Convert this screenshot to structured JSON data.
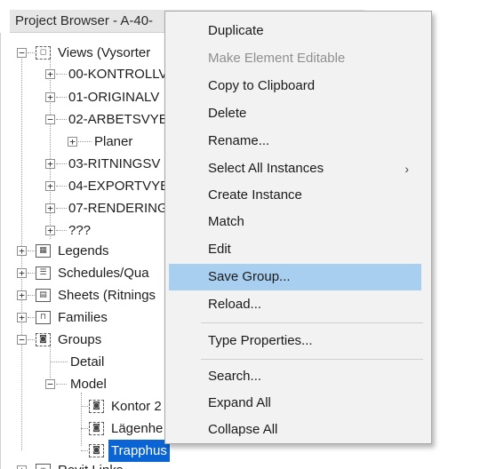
{
  "browser": {
    "title": "Project Browser - A-40-",
    "tree": {
      "views": "Views (Vysorter",
      "kontroll": "00-KONTROLLV",
      "originalv": "01-ORIGINALV",
      "arbetsvy": "02-ARBETSVYE",
      "planer": "Planer",
      "ritnings": "03-RITNINGSV",
      "export": "04-EXPORTVYE",
      "rendering": "07-RENDERING",
      "unknown": "???",
      "legends": "Legends",
      "schedules": "Schedules/Qua",
      "sheets": "Sheets (Ritnings",
      "families": "Families",
      "groups": "Groups",
      "detail": "Detail",
      "model": "Model",
      "kontor": "Kontor 2",
      "lagenhet": "Lägenhe",
      "trapphus": "Trapphus",
      "revit_links": "Revit Links"
    }
  },
  "context_menu": {
    "items": [
      {
        "label": "Duplicate",
        "enabled": true
      },
      {
        "label": "Make Element Editable",
        "enabled": false
      },
      {
        "label": "Copy to Clipboard",
        "enabled": true
      },
      {
        "label": "Delete",
        "enabled": true
      },
      {
        "label": "Rename...",
        "enabled": true
      },
      {
        "label": "Select All Instances",
        "enabled": true,
        "submenu": true
      },
      {
        "label": "Create Instance",
        "enabled": true
      },
      {
        "label": "Match",
        "enabled": true
      },
      {
        "label": "Edit",
        "enabled": true
      },
      {
        "label": "Save Group...",
        "enabled": true,
        "highlighted": true
      },
      {
        "label": "Reload...",
        "enabled": true
      },
      {
        "label": "Type Properties...",
        "enabled": true
      },
      {
        "label": "Search...",
        "enabled": true
      },
      {
        "label": "Expand All",
        "enabled": true
      },
      {
        "label": "Collapse All",
        "enabled": true
      }
    ],
    "submenu_arrow": "›"
  },
  "colors": {
    "selection": "#0a64d4",
    "menu_hover": "#a9cff0",
    "menu_background": "#f2f2f2"
  }
}
